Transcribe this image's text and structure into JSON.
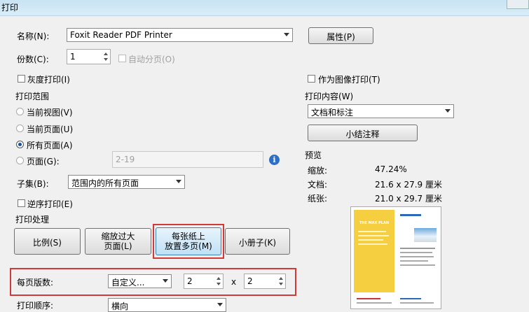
{
  "window": {
    "title": "打印"
  },
  "printer": {
    "name_label": "名称(N):",
    "name_value": "Foxit Reader PDF Printer",
    "properties_label": "属性(P)"
  },
  "copies": {
    "label": "份数(C):",
    "value": "1",
    "collate_label": "自动分页(O)"
  },
  "options": {
    "grayscale_label": "灰度打印(I)",
    "as_image_label": "作为图像打印(T)"
  },
  "print_range": {
    "title": "打印范围",
    "current_view": "当前视图(V)",
    "current_page": "当前页面(U)",
    "all_pages": "所有页面(A)",
    "pages_label": "页面(G):",
    "pages_value": "2-19",
    "subset_label": "子集(B):",
    "subset_value": "范围内的所有页面",
    "reverse_label": "逆序打印(E)"
  },
  "print_content": {
    "title": "打印内容(W)",
    "value": "文档和标注",
    "summarize_label": "小结注释"
  },
  "preview": {
    "title": "预览",
    "zoom_label": "缩放:",
    "zoom_value": "47.24%",
    "doc_label": "文档:",
    "doc_value": "21.6 x 27.9 厘米",
    "paper_label": "纸张:",
    "paper_value": "21.0 x 29.7 厘米"
  },
  "handling": {
    "title": "打印处理",
    "scale_label": "比例(S)",
    "fit_line1": "缩放过大",
    "fit_line2": "页面(L)",
    "multi_line1": "每张纸上",
    "multi_line2": "放置多页(M)",
    "booklet_label": "小册子(K)"
  },
  "pages_per_sheet": {
    "label": "每页版数:",
    "mode_value": "自定义...",
    "cols": "2",
    "x_sep": "x",
    "rows": "2"
  },
  "order": {
    "label": "打印顺序:",
    "value": "横向"
  },
  "page_preview": {
    "heading": "THE MAX PLAN"
  }
}
